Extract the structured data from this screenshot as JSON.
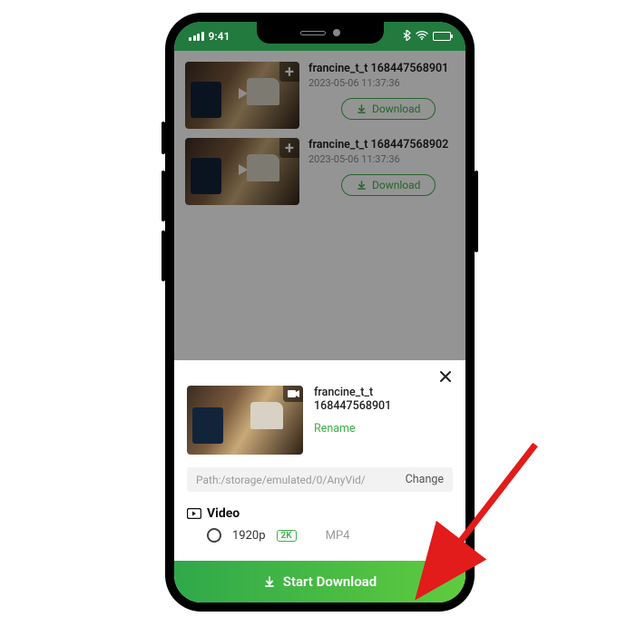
{
  "statusbar": {
    "time": "9:41"
  },
  "colors": {
    "accent": "#3fae4a",
    "header": "#227a3e"
  },
  "list": {
    "items": [
      {
        "title": "francine_t_t 168447568901",
        "date": "2023-05-06 11:37:36",
        "download_label": "Download"
      },
      {
        "title": "francine_t_t 168447568902",
        "date": "2023-05-06 11:37:36",
        "download_label": "Download"
      }
    ]
  },
  "sheet": {
    "title": "francine_t_t 168447568901",
    "rename_label": "Rename",
    "path_display": "Path:/storage/emulated/0/AnyVid/",
    "change_label": "Change",
    "video_section_label": "Video",
    "option": {
      "resolution": "1920p",
      "badge": "2K",
      "format": "MP4"
    },
    "start_label": "Start Download"
  }
}
